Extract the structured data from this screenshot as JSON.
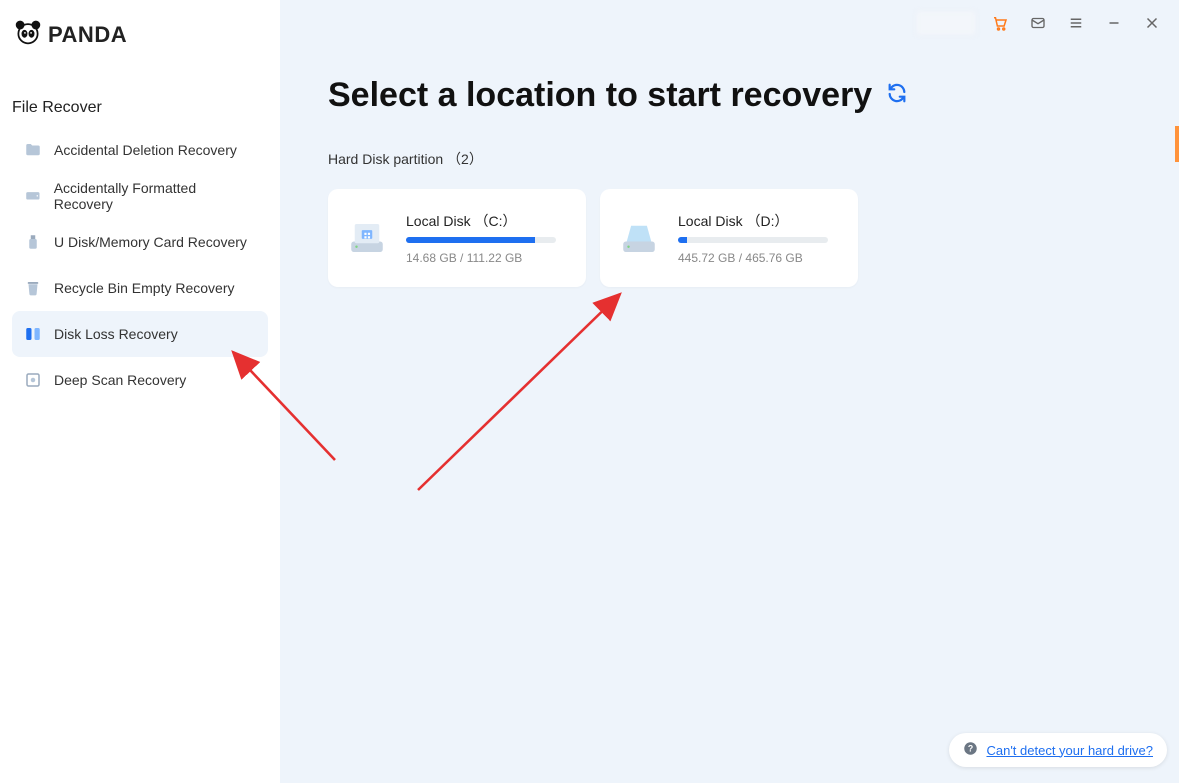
{
  "brand": {
    "name": "PANDA"
  },
  "sidebar": {
    "title": "File Recover",
    "items": [
      {
        "label": "Accidental Deletion Recovery",
        "icon": "folder-icon",
        "active": false
      },
      {
        "label": "Accidentally Formatted Recovery",
        "icon": "drive-icon",
        "active": false
      },
      {
        "label": "U Disk/Memory Card Recovery",
        "icon": "usb-icon",
        "active": false
      },
      {
        "label": "Recycle Bin Empty Recovery",
        "icon": "trash-icon",
        "active": false
      },
      {
        "label": "Disk Loss Recovery",
        "icon": "partition-icon",
        "active": true
      },
      {
        "label": "Deep Scan Recovery",
        "icon": "scan-icon",
        "active": false
      }
    ]
  },
  "main": {
    "title": "Select a location to start recovery",
    "section_label": "Hard Disk partition （2）",
    "disks": [
      {
        "name": "Local Disk （C:）",
        "used": "14.68 GB",
        "total": "111.22 GB",
        "fill_pct": 86,
        "kind": "system"
      },
      {
        "name": "Local Disk （D:）",
        "used": "445.72 GB",
        "total": "465.76 GB",
        "fill_pct": 6,
        "kind": "data"
      }
    ]
  },
  "help_link": {
    "text": "Can't detect your hard drive?"
  },
  "titlebar": {
    "buttons": [
      "cart-icon",
      "mail-icon",
      "menu-icon",
      "minimize-icon",
      "close-icon"
    ]
  },
  "colors": {
    "accent": "#1E6FF0",
    "bg": "#eef4fb",
    "arrow": "#E53030"
  }
}
